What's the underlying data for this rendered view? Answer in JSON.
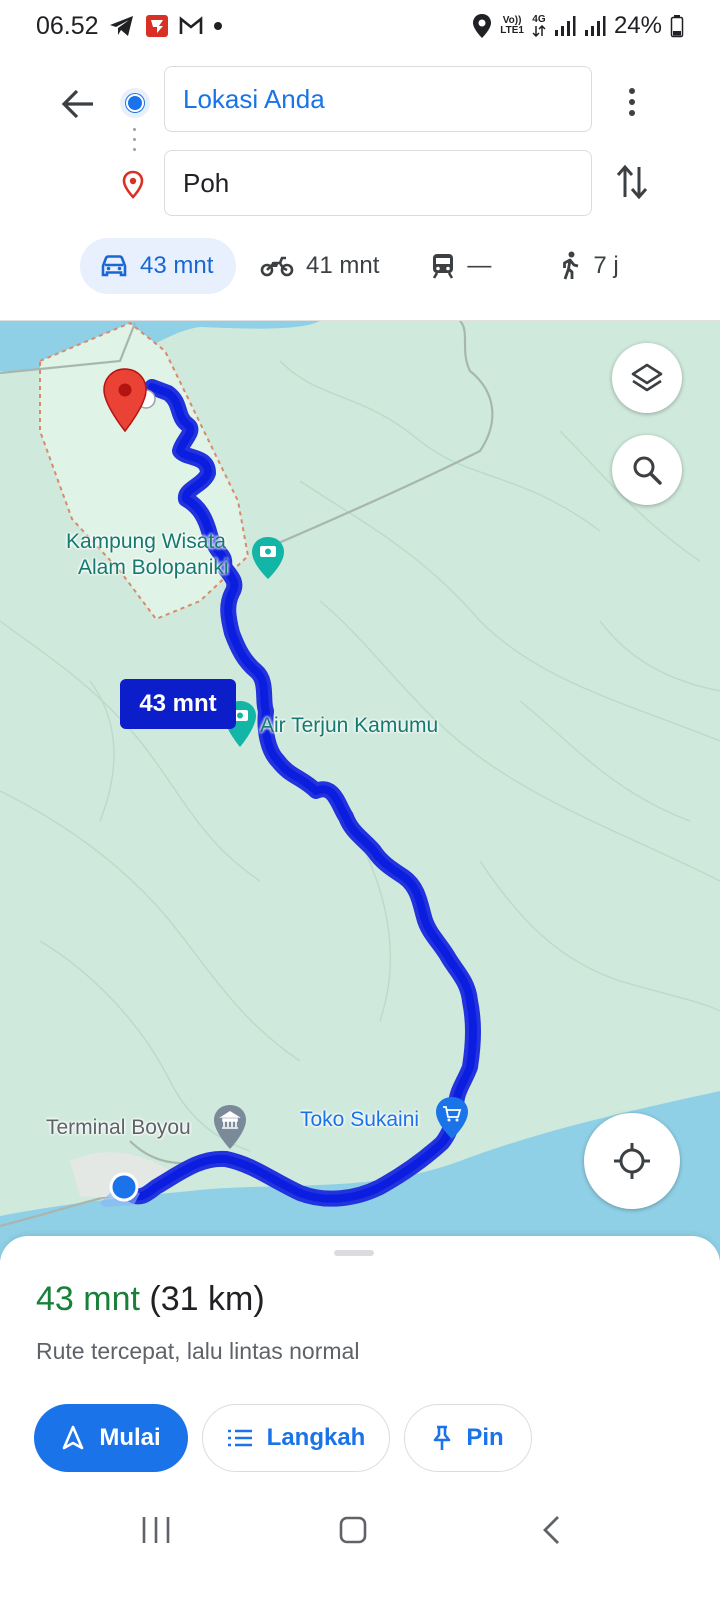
{
  "status_bar": {
    "time": "06.52",
    "net_top": "Vo))",
    "net_bottom": "LTE1",
    "net_type": "4G",
    "battery": "24%"
  },
  "directions": {
    "origin": "Lokasi Anda",
    "destination": "Poh",
    "modes": [
      {
        "name": "car",
        "label": "43 mnt",
        "active": true
      },
      {
        "name": "motorcycle",
        "label": "41 mnt",
        "active": false
      },
      {
        "name": "transit",
        "label": "—",
        "active": false
      },
      {
        "name": "walk",
        "label": "7 j",
        "active": false
      }
    ]
  },
  "map": {
    "route_time_bubble": "43 mnt",
    "places": [
      {
        "name": "Kampung Wisata Alam Bolopaniki",
        "lines": [
          "Kampung Wisata",
          "Alam Bolopaniki"
        ],
        "icon": "camera-icon"
      },
      {
        "name": "Air Terjun Kamumu",
        "icon": "camera-icon"
      },
      {
        "name": "Terminal Boyou",
        "icon": "bank-icon"
      },
      {
        "name": "Toko Sukaini",
        "icon": "cart-icon"
      }
    ],
    "colors": {
      "route": "#0b1ee0",
      "land": "#cfe9dc",
      "water": "#8fd0e6"
    }
  },
  "sheet": {
    "duration": "43 mnt",
    "distance": "(31 km)",
    "description": "Rute tercepat, lalu lintas normal",
    "buttons": {
      "start": "Mulai",
      "steps": "Langkah",
      "pin": "Pin"
    }
  }
}
